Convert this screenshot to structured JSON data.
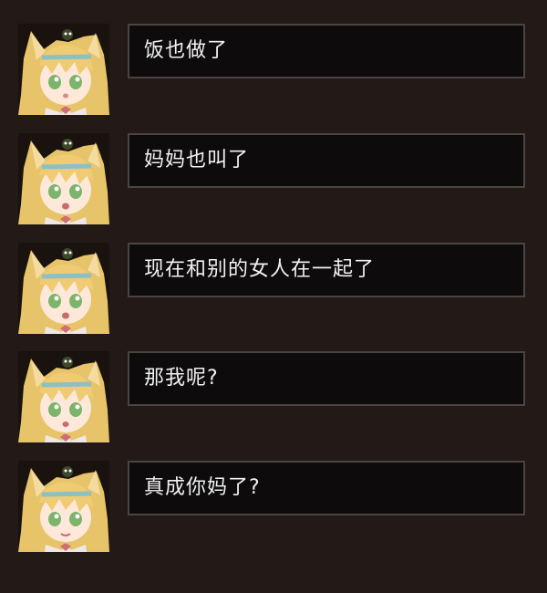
{
  "messages": [
    {
      "text": "饭也做了",
      "avatar_icon": "fox-girl-avatar-icon"
    },
    {
      "text": "妈妈也叫了",
      "avatar_icon": "fox-girl-avatar-icon"
    },
    {
      "text": "现在和别的女人在一起了",
      "avatar_icon": "fox-girl-avatar-icon"
    },
    {
      "text": "那我呢?",
      "avatar_icon": "fox-girl-avatar-icon"
    },
    {
      "text": "真成你妈了?",
      "avatar_icon": "fox-girl-avatar-icon"
    }
  ],
  "colors": {
    "background": "#231916",
    "bubble": "#0d0b0b",
    "bubble_border": "#4b4542",
    "text": "#f2f2f2",
    "hair": "#e9c76a",
    "eyes": "#74b36b"
  }
}
